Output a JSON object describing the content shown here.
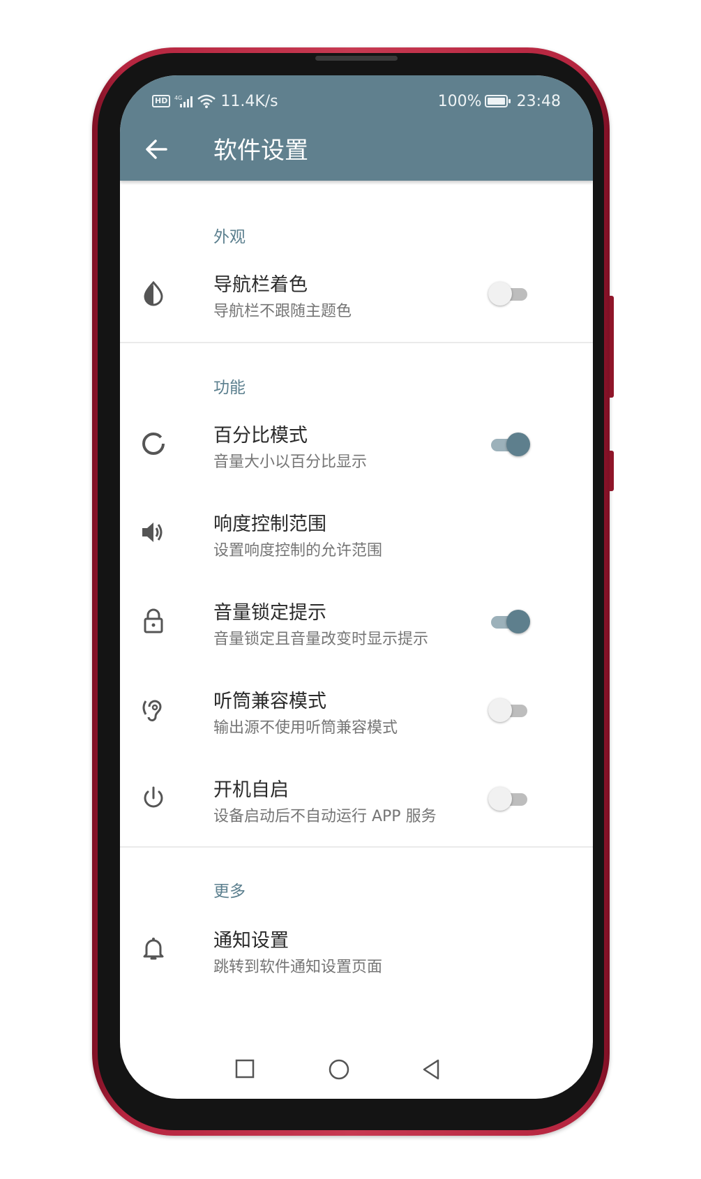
{
  "status_bar": {
    "network": "11.4K/s",
    "battery": "100%",
    "time": "23:48",
    "hd_label": "HD",
    "signal_label": "4G"
  },
  "app_bar": {
    "title": "软件设置"
  },
  "sections": [
    {
      "header": "外观"
    },
    {
      "header": "功能"
    },
    {
      "header": "更多"
    }
  ],
  "items": [
    {
      "title": "导航栏着色",
      "subtitle": "导航栏不跟随主题色",
      "icon": "contrast-drop-icon",
      "toggle": false
    },
    {
      "title": "百分比模式",
      "subtitle": "音量大小以百分比显示",
      "icon": "percent-ring-icon",
      "toggle": true
    },
    {
      "title": "响度控制范围",
      "subtitle": "设置响度控制的允许范围",
      "icon": "speaker-icon"
    },
    {
      "title": "音量锁定提示",
      "subtitle": "音量锁定且音量改变时显示提示",
      "icon": "lock-icon",
      "toggle": true
    },
    {
      "title": "听筒兼容模式",
      "subtitle": "输出源不使用听筒兼容模式",
      "icon": "ear-icon",
      "toggle": false
    },
    {
      "title": "开机自启",
      "subtitle": "设备启动后不自动运行 APP 服务",
      "icon": "power-icon",
      "toggle": false
    },
    {
      "title": "通知设置",
      "subtitle": "跳转到软件通知设置页面",
      "icon": "bell-icon"
    }
  ],
  "colors": {
    "primary": "#60808e",
    "accent": "#5e7f8d",
    "frame": "#c73a52"
  }
}
